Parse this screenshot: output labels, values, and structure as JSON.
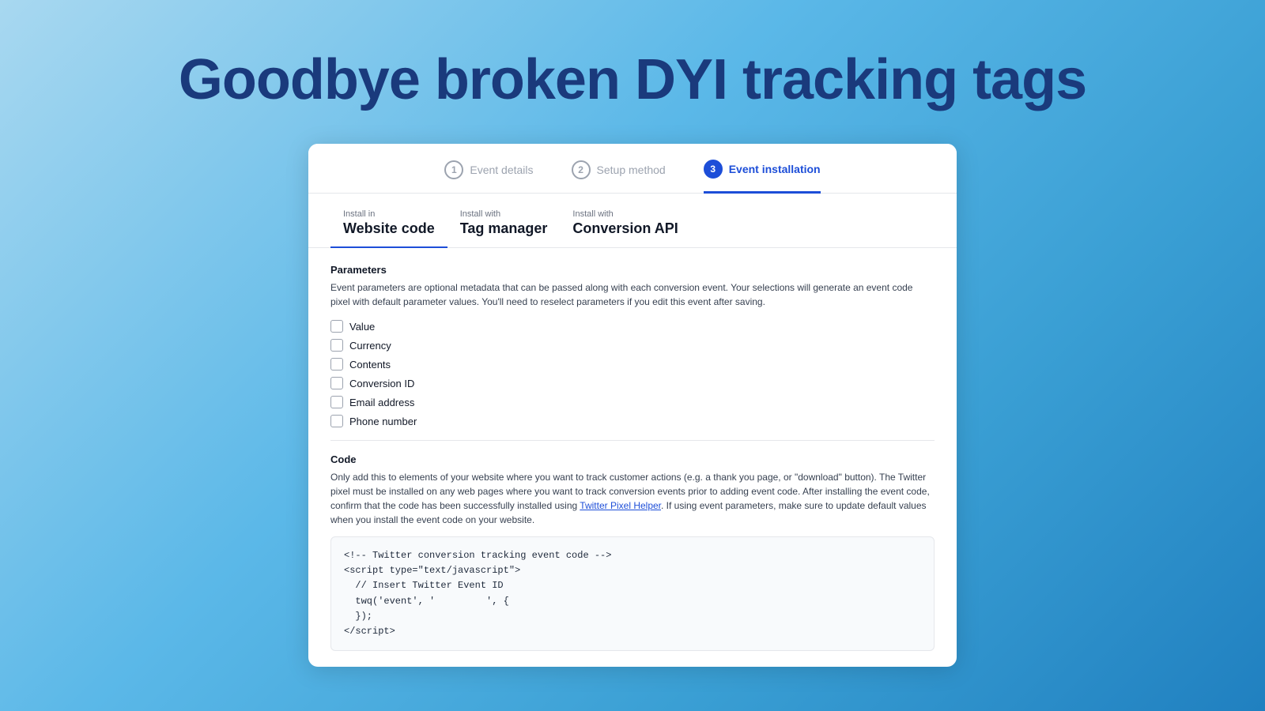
{
  "hero": {
    "title": "Goodbye broken DYI tracking tags"
  },
  "steps": [
    {
      "number": "1",
      "label": "Event details",
      "state": "inactive"
    },
    {
      "number": "2",
      "label": "Setup method",
      "state": "inactive"
    },
    {
      "number": "3",
      "label": "Event installation",
      "state": "active"
    }
  ],
  "tabs": [
    {
      "sub": "Install in",
      "main": "Website code",
      "active": true
    },
    {
      "sub": "Install with",
      "main": "Tag manager",
      "active": false
    },
    {
      "sub": "Install with",
      "main": "Conversion API",
      "active": false
    }
  ],
  "parameters": {
    "section_title": "Parameters",
    "description": "Event parameters are optional metadata that can be passed along with each conversion event. Your selections will generate an event code pixel with default parameter values. You'll need to reselect parameters if you edit this event after saving.",
    "checkboxes": [
      "Value",
      "Currency",
      "Contents",
      "Conversion ID",
      "Email address",
      "Phone number"
    ]
  },
  "code": {
    "section_title": "Code",
    "description_start": "Only add this to elements of your website where you want to track customer actions (e.g. a thank you page, or \"download\" button). The Twitter pixel must be installed on any web pages where you want to track conversion events prior to adding event code. After installing the event code, confirm that the code has been successfully installed using ",
    "link_text": "Twitter Pixel Helper",
    "description_end": ". If using event parameters, make sure to update default values when you install the event code on your website.",
    "code_snippet": "<!-- Twitter conversion tracking event code -->\n<script type=\"text/javascript\">\n  // Insert Twitter Event ID\n  twq('event', '         ', {\n  });\n</scri​pt>"
  }
}
